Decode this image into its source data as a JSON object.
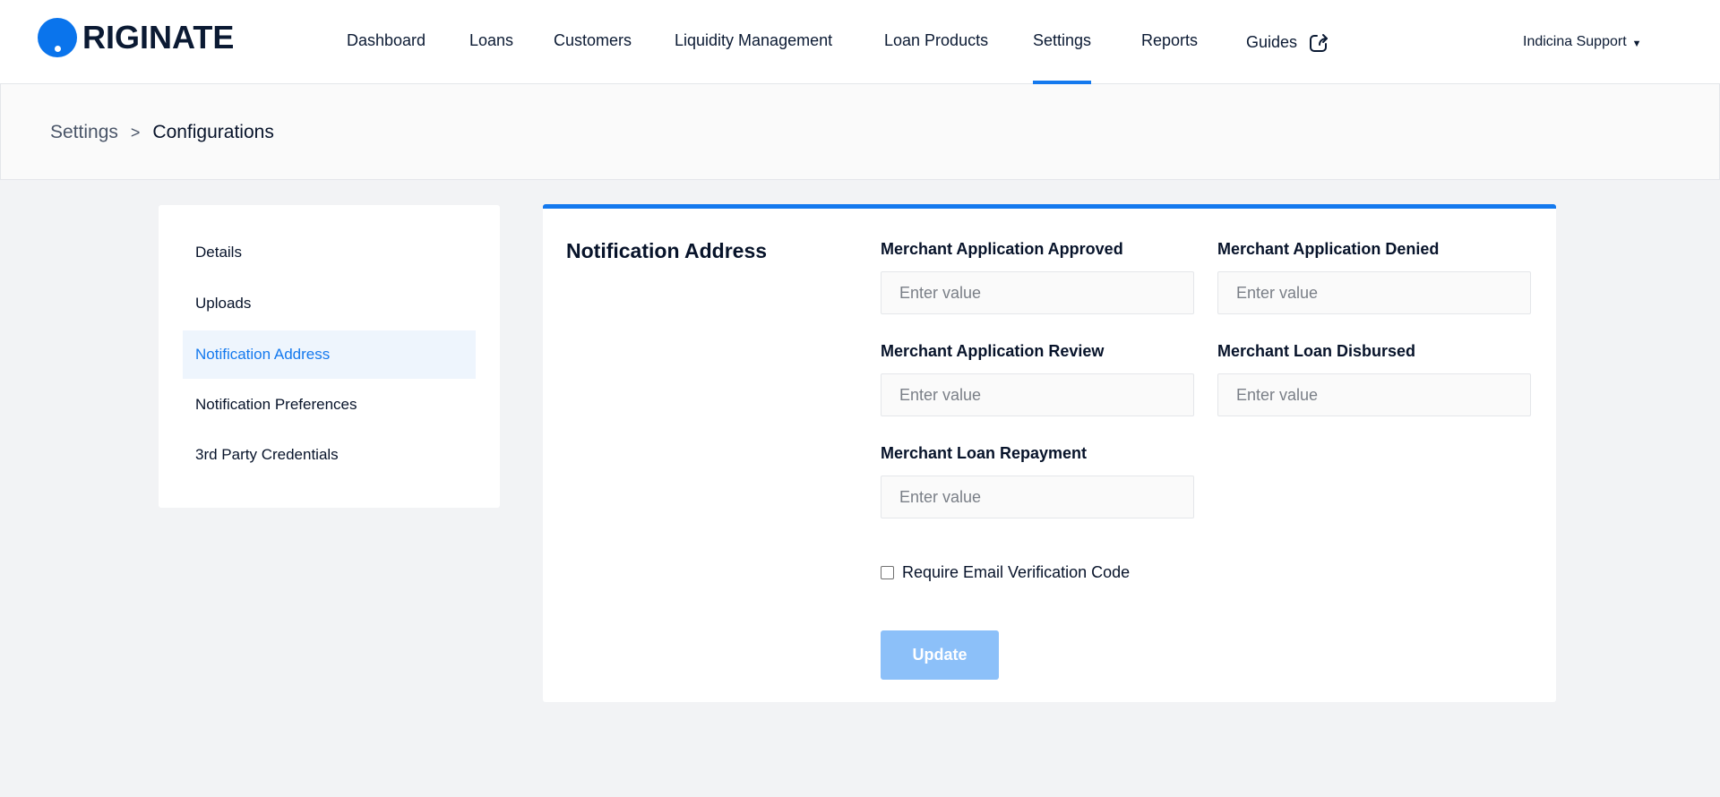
{
  "brand": {
    "name": "RIGINATE",
    "accent": "#1479ee"
  },
  "nav": {
    "items": [
      {
        "label": "Dashboard"
      },
      {
        "label": "Loans"
      },
      {
        "label": "Customers"
      },
      {
        "label": "Liquidity Management"
      },
      {
        "label": "Loan Products"
      },
      {
        "label": "Settings",
        "active": true
      },
      {
        "label": "Reports"
      },
      {
        "label": "Guides",
        "icon": "external-link-icon"
      }
    ],
    "user": {
      "name": "Indicina Support",
      "icon": "caret-down-icon"
    }
  },
  "breadcrumb": {
    "parent": "Settings",
    "separator": ">",
    "current": "Configurations"
  },
  "sidebar": {
    "items": [
      {
        "label": "Details"
      },
      {
        "label": "Uploads"
      },
      {
        "label": "Notification Address",
        "active": true
      },
      {
        "label": "Notification Preferences"
      },
      {
        "label": "3rd Party Credentials"
      }
    ]
  },
  "panel": {
    "title": "Notification Address",
    "fields": [
      {
        "label": "Merchant Application Approved",
        "placeholder": "Enter value",
        "value": ""
      },
      {
        "label": "Merchant Application Denied",
        "placeholder": "Enter value",
        "value": ""
      },
      {
        "label": "Merchant Application Review",
        "placeholder": "Enter value",
        "value": ""
      },
      {
        "label": "Merchant Loan Disbursed",
        "placeholder": "Enter value",
        "value": ""
      },
      {
        "label": "Merchant Loan Repayment",
        "placeholder": "Enter value",
        "value": ""
      }
    ],
    "checkbox": {
      "label": "Require Email Verification Code",
      "checked": false
    },
    "submit_label": "Update"
  }
}
